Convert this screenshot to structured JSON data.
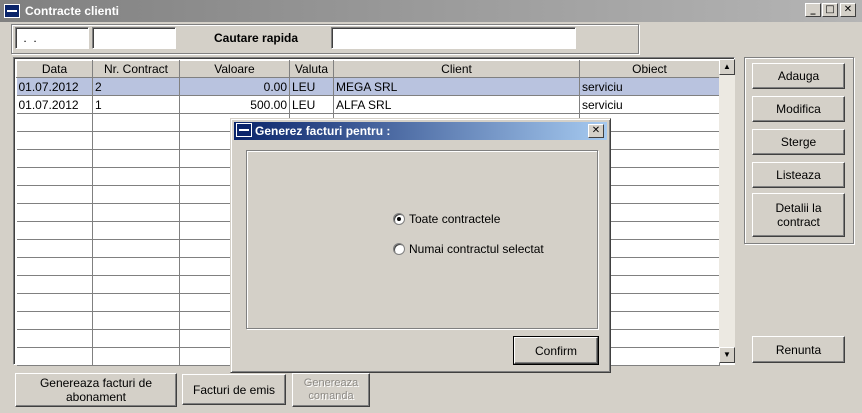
{
  "window": {
    "title": "Contracte clienti",
    "minimize_glyph": "_",
    "maximize_glyph": "□",
    "close_glyph": "✕"
  },
  "search": {
    "date_value": " .  .",
    "number_value": "",
    "quick_search_label": "Cautare rapida",
    "quick_search_value": ""
  },
  "table": {
    "columns": [
      "Data",
      "Nr. Contract",
      "Valoare",
      "Valuta",
      "Client",
      "Obiect"
    ],
    "rows": [
      {
        "data": "01.07.2012",
        "nr": "2",
        "valoare": "0.00",
        "valuta": "LEU",
        "client": "MEGA SRL",
        "obiect": "serviciu"
      },
      {
        "data": "01.07.2012",
        "nr": "1",
        "valoare": "500.00",
        "valuta": "LEU",
        "client": "ALFA SRL",
        "obiect": "serviciu"
      }
    ],
    "selected_row": 0
  },
  "scrollbar": {
    "up_glyph": "▲",
    "down_glyph": "▼"
  },
  "right_buttons": {
    "adauga": "Adauga",
    "modifica": "Modifica",
    "sterge": "Sterge",
    "listeaza": "Listeaza",
    "detalii": "Detalii la contract",
    "renunta": "Renunta"
  },
  "bottom_buttons": {
    "genereaza_facturi": "Genereaza facturi de abonament",
    "facturi_emis": "Facturi de emis",
    "genereaza_comanda": "Genereaza comanda"
  },
  "dialog": {
    "title": "Generez facturi pentru :",
    "close_glyph": "✕",
    "options": [
      {
        "label": "Toate contractele",
        "checked": true
      },
      {
        "label": "Numai contractul selectat",
        "checked": false
      }
    ],
    "confirm_label": "Confirm"
  }
}
